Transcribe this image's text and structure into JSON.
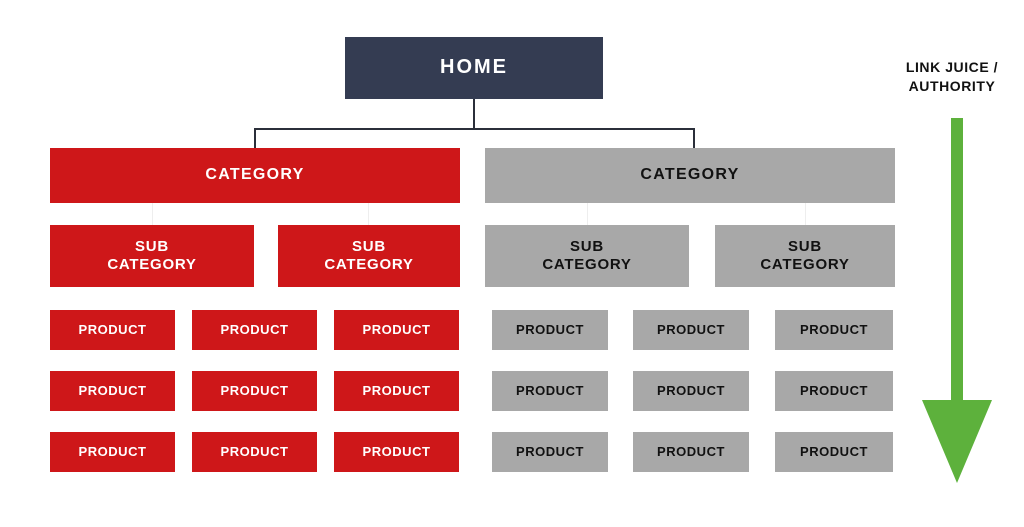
{
  "diagram": {
    "title_node": {
      "label": "HOME"
    },
    "annotation": {
      "line1": "LINK JUICE /",
      "line2": "AUTHORITY",
      "arrow_icon": "arrow-down-icon",
      "arrow_color": "#5DB13C",
      "arrow_direction": "down"
    },
    "colors": {
      "home": "#343C52",
      "branch_primary": "#CE1719",
      "branch_secondary": "#A8A8A8",
      "arrow": "#5DB13C",
      "connector": "#2B2F3A",
      "background": "#FFFFFF",
      "text_light": "#FFFFFF",
      "text_dark": "#111111"
    },
    "branches": [
      {
        "id": "left",
        "color_key": "branch_primary",
        "category": {
          "label": "CATEGORY"
        },
        "subcategories": [
          {
            "line1": "SUB",
            "line2": "CATEGORY"
          },
          {
            "line1": "SUB",
            "line2": "CATEGORY"
          }
        ],
        "product_rows": [
          [
            "PRODUCT",
            "PRODUCT",
            "PRODUCT"
          ],
          [
            "PRODUCT",
            "PRODUCT",
            "PRODUCT"
          ],
          [
            "PRODUCT",
            "PRODUCT",
            "PRODUCT"
          ]
        ]
      },
      {
        "id": "right",
        "color_key": "branch_secondary",
        "category": {
          "label": "CATEGORY"
        },
        "subcategories": [
          {
            "line1": "SUB",
            "line2": "CATEGORY"
          },
          {
            "line1": "SUB",
            "line2": "CATEGORY"
          }
        ],
        "product_rows": [
          [
            "PRODUCT",
            "PRODUCT",
            "PRODUCT"
          ],
          [
            "PRODUCT",
            "PRODUCT",
            "PRODUCT"
          ],
          [
            "PRODUCT",
            "PRODUCT",
            "PRODUCT"
          ]
        ]
      }
    ]
  }
}
